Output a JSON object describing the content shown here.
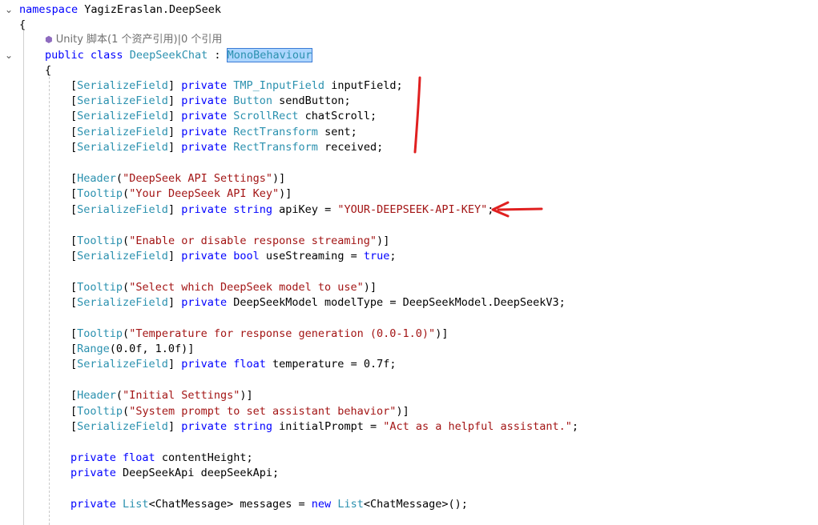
{
  "code": {
    "ns_kw": "namespace",
    "ns_name": "YagizEraslan.DeepSeek",
    "open_brace": "{",
    "codelens": "Unity 脚本(1 个资产引用)|0 个引用",
    "codelens_icon": "unity-icon",
    "class_kw": "public class",
    "class_name": "DeepSeekChat",
    "colon": " : ",
    "base_class": "MonoBehaviour",
    "class_open_brace": "{",
    "attr_open": "[",
    "attr_close": "]",
    "serialize_field": "SerializeField",
    "private": "private",
    "f1_type": "TMP_InputField",
    "f1_rest": " inputField;",
    "f2_type": "Button",
    "f2_rest": " sendButton;",
    "f3_type": "ScrollRect",
    "f3_rest": " chatScroll;",
    "f4_type": "RectTransform",
    "f4_rest": " sent;",
    "f5_type": "RectTransform",
    "f5_rest": " received;",
    "header": "Header",
    "tooltip": "Tooltip",
    "range": "Range",
    "h1_str": "\"DeepSeek API Settings\"",
    "t1_str": "\"Your DeepSeek API Key\"",
    "string_kw": "string",
    "api_key_name": " apiKey = ",
    "api_key_value": "\"YOUR-DEEPSEEK-API-KEY\"",
    "semicolon": ";",
    "paren_open": "(",
    "paren_close": ")",
    "t2_str": "\"Enable or disable response streaming\"",
    "bool_kw": "bool",
    "use_streaming": " useStreaming = ",
    "true_kw": "true",
    "t3_str": "\"Select which DeepSeek model to use\"",
    "model_line": " DeepSeekModel modelType = DeepSeekModel.DeepSeekV3;",
    "t4_str": "\"Temperature for response generation (0.0-1.0)\"",
    "range_args": "(0.0f, 1.0f)",
    "float_kw": "float",
    "temp_rest": " temperature = 0.7f;",
    "h2_str": "\"Initial Settings\"",
    "t5_str": "\"System prompt to set assistant behavior\"",
    "prompt_name": " initialPrompt = ",
    "prompt_value": "\"Act as a helpful assistant.\"",
    "content_height": " contentHeight;",
    "api_line": " DeepSeekApi deepSeekApi;",
    "list_type": "List",
    "list_generic": "<ChatMessage>",
    "messages_rest": " messages = ",
    "new_kw": "new",
    "ctor_end": "();",
    "space": " "
  },
  "colors": {
    "keyword": "#0000ff",
    "type": "#2b91af",
    "string": "#a31515",
    "annotation": "#e02020"
  }
}
